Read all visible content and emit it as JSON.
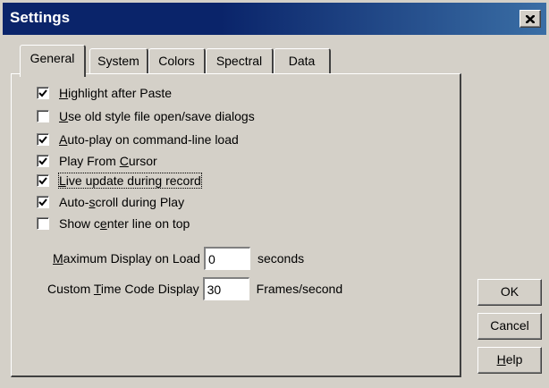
{
  "window": {
    "title": "Settings"
  },
  "tabs": [
    {
      "label": "General",
      "active": true
    },
    {
      "label": "System",
      "active": false
    },
    {
      "label": "Colors",
      "active": false
    },
    {
      "label": "Spectral",
      "active": false
    },
    {
      "label": "Data",
      "active": false
    }
  ],
  "options": [
    {
      "pre": "",
      "u": "H",
      "post": "ighlight after Paste",
      "checked": true
    },
    {
      "pre": "",
      "u": "U",
      "post": "se old style file open/save dialogs",
      "checked": false
    },
    {
      "pre": "",
      "u": "A",
      "post": "uto-play on command-line load",
      "checked": true
    },
    {
      "pre": "Play From ",
      "u": "C",
      "post": "ursor",
      "checked": true
    },
    {
      "pre": "",
      "u": "L",
      "post": "ive update during record",
      "checked": true,
      "focused": true
    },
    {
      "pre": "Auto-",
      "u": "s",
      "post": "croll during Play",
      "checked": true
    },
    {
      "pre": "Show c",
      "u": "e",
      "post": "nter line on top",
      "checked": false
    }
  ],
  "max_display": {
    "pre": "",
    "u": "M",
    "post": "aximum Display on Load",
    "value": "0",
    "unit": "seconds"
  },
  "time_code": {
    "pre": "Custom ",
    "u": "T",
    "post": "ime Code Display",
    "value": "30",
    "unit": "Frames/second"
  },
  "buttons": {
    "ok": "OK",
    "cancel": "Cancel",
    "help_u": "H",
    "help_post": "elp"
  },
  "icons": {
    "close": "close-icon",
    "check": "checkmark-icon"
  }
}
